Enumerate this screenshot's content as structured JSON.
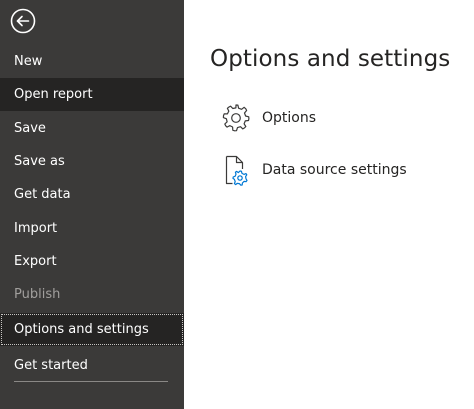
{
  "sidebar": {
    "back_icon": "back-arrow-icon",
    "items": [
      {
        "label": "New",
        "state": "normal"
      },
      {
        "label": "Open report",
        "state": "hover"
      },
      {
        "label": "Save",
        "state": "normal"
      },
      {
        "label": "Save as",
        "state": "normal"
      },
      {
        "label": "Get data",
        "state": "normal"
      },
      {
        "label": "Import",
        "state": "normal"
      },
      {
        "label": "Export",
        "state": "normal"
      },
      {
        "label": "Publish",
        "state": "disabled"
      },
      {
        "label": "Options and settings",
        "state": "selected"
      },
      {
        "label": "Get started",
        "state": "normal"
      }
    ]
  },
  "main": {
    "title": "Options and settings",
    "options": [
      {
        "label": "Options",
        "icon": "gear-icon"
      },
      {
        "label": "Data source settings",
        "icon": "data-source-settings-icon"
      }
    ]
  },
  "colors": {
    "sidebar_bg": "#3b3a39",
    "sidebar_hover_bg": "#252423",
    "sidebar_text": "#ffffff",
    "sidebar_disabled_text": "#a19f9d",
    "accent_blue": "#0078d4",
    "main_text": "#252423"
  }
}
